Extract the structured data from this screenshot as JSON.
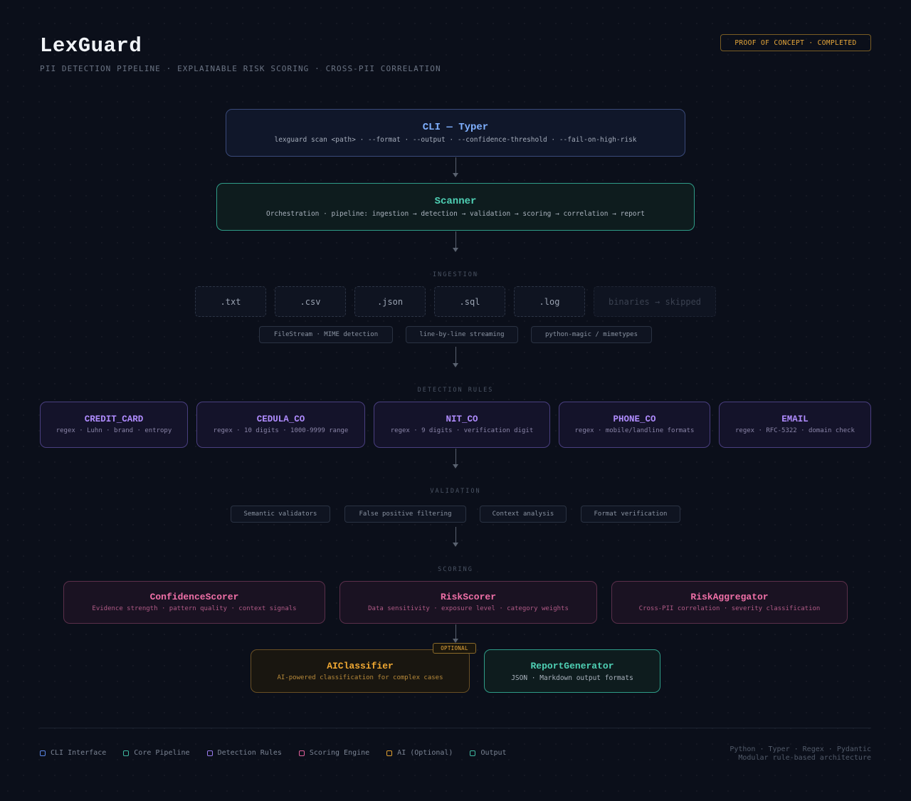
{
  "header": {
    "title": "LexGuard",
    "subtitle": "PII DETECTION PIPELINE · EXPLAINABLE RISK SCORING · CROSS-PII CORRELATION",
    "badge": "PROOF OF CONCEPT · COMPLETED"
  },
  "cli": {
    "title": "CLI — Typer",
    "desc": "lexguard scan <path> · --format · --output · --confidence-threshold · --fail-on-high-risk"
  },
  "scanner": {
    "title": "Scanner",
    "desc": "Orchestration · pipeline: ingestion → detection → validation → scoring → correlation → report"
  },
  "ingestion": {
    "label": "INGESTION",
    "formats": [
      ".txt",
      ".csv",
      ".json",
      ".sql",
      ".log"
    ],
    "skipped": "binaries → skipped",
    "chips": [
      "FileStream · MIME detection",
      "line-by-line streaming",
      "python-magic / mimetypes"
    ]
  },
  "detection": {
    "label": "DETECTION RULES",
    "rules": [
      {
        "name": "CREDIT_CARD",
        "desc": "regex · Luhn · brand · entropy"
      },
      {
        "name": "CEDULA_CO",
        "desc": "regex · 10 digits · 1000-9999 range"
      },
      {
        "name": "NIT_CO",
        "desc": "regex · 9 digits · verification digit"
      },
      {
        "name": "PHONE_CO",
        "desc": "regex · mobile/landline formats"
      },
      {
        "name": "EMAIL",
        "desc": "regex · RFC-5322 · domain check"
      }
    ]
  },
  "validation": {
    "label": "VALIDATION",
    "chips": [
      "Semantic validators",
      "False positive filtering",
      "Context analysis",
      "Format verification"
    ]
  },
  "scoring": {
    "label": "SCORING",
    "items": [
      {
        "name": "ConfidenceScorer",
        "desc": "Evidence strength · pattern quality · context signals"
      },
      {
        "name": "RiskScorer",
        "desc": "Data sensitivity · exposure level · category weights"
      },
      {
        "name": "RiskAggregator",
        "desc": "Cross-PII correlation · severity classification"
      }
    ]
  },
  "ai": {
    "title": "AIClassifier",
    "desc": "AI-powered classification for complex cases",
    "badge": "OPTIONAL"
  },
  "report": {
    "title": "ReportGenerator",
    "desc": "JSON · Markdown output formats"
  },
  "legend": [
    {
      "label": "CLI Interface",
      "color": "#5b86e5"
    },
    {
      "label": "Core Pipeline",
      "color": "#3fb8a0"
    },
    {
      "label": "Detection Rules",
      "color": "#9b7cf0"
    },
    {
      "label": "Scoring Engine",
      "color": "#e0609a"
    },
    {
      "label": "AI (Optional)",
      "color": "#e0a030"
    },
    {
      "label": "Output",
      "color": "#3fb8a0"
    }
  ],
  "footer": {
    "line1": "Python · Typer · Regex · Pydantic",
    "line2": "Modular rule-based architecture"
  }
}
